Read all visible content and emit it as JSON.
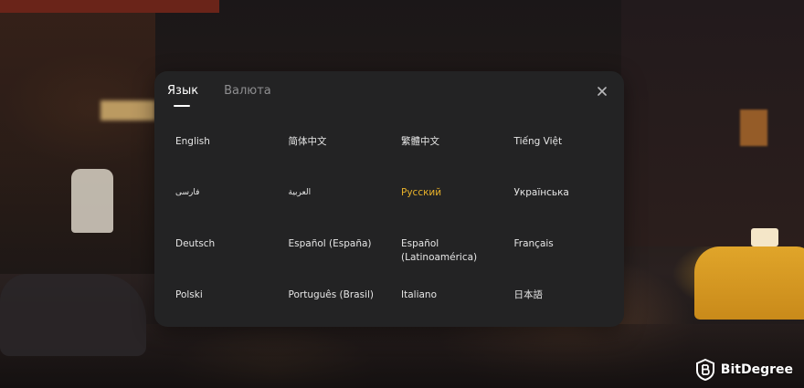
{
  "tabs": [
    {
      "label": "Язык",
      "active": true
    },
    {
      "label": "Валюта",
      "active": false
    }
  ],
  "close": {
    "icon": "close-icon"
  },
  "languages": [
    {
      "label": "English"
    },
    {
      "label": "简体中文"
    },
    {
      "label": "繁體中文"
    },
    {
      "label": "Tiếng Việt"
    },
    {
      "label": "فارسی"
    },
    {
      "label": "العربية"
    },
    {
      "label": "Русский",
      "selected": true
    },
    {
      "label": "Українська"
    },
    {
      "label": "Deutsch"
    },
    {
      "label": "Español (España)"
    },
    {
      "label": "Español (Latinoamérica)"
    },
    {
      "label": "Français"
    },
    {
      "label": "Polski"
    },
    {
      "label": "Português (Brasil)"
    },
    {
      "label": "Italiano"
    },
    {
      "label": "日本語"
    }
  ],
  "colors": {
    "modal_background": "#232324",
    "selected_accent": "#e9b22a",
    "text": "#e6e6e6",
    "inactive_tab": "#8e8e90"
  },
  "watermark": {
    "text": "BitDegree"
  }
}
